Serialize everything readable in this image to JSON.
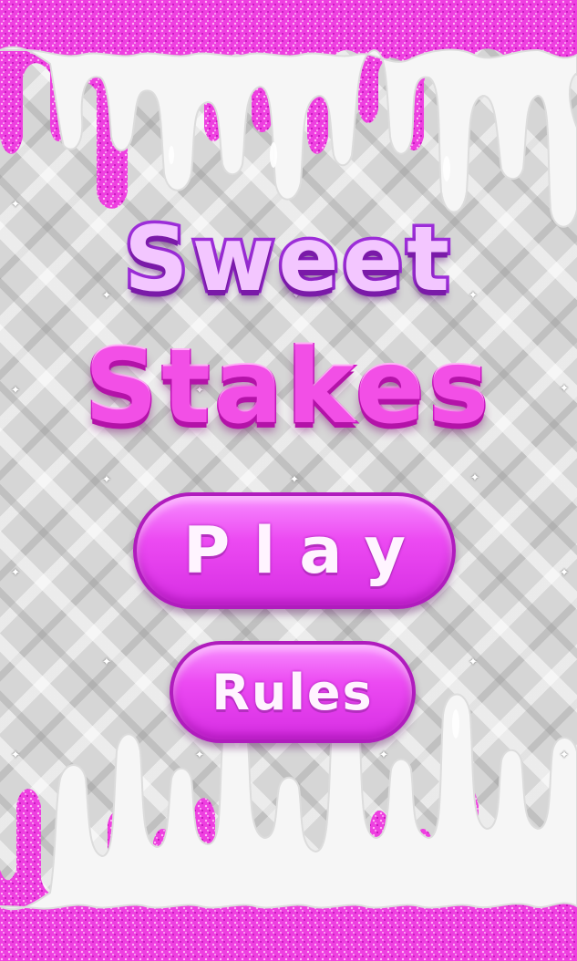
{
  "game": {
    "title_line1": "Sweet",
    "title_line2": "Stakes"
  },
  "menu": {
    "play_label": "Play",
    "rules_label": "Rules"
  },
  "colors": {
    "glitter": "#ee3fe0",
    "slime": "#f4f4f4",
    "button": "#ec4af2",
    "title_purple": "#9c2dd8",
    "title_pink": "#f24fe6"
  },
  "decor": {
    "sparkle_glyph": "✦"
  }
}
